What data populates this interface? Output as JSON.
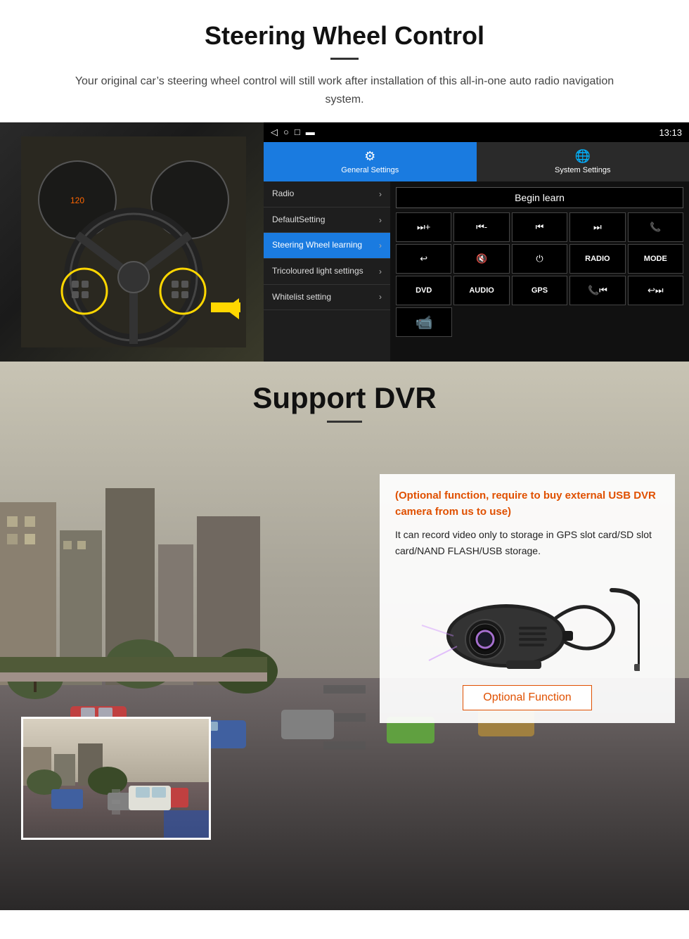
{
  "steering_section": {
    "title": "Steering Wheel Control",
    "subtitle": "Your original car’s steering wheel control will still work after installation of this all-in-one auto radio navigation system.",
    "status_bar": {
      "time": "13:13",
      "icons": [
        "◁",
        "○",
        "□",
        "▬"
      ]
    },
    "tabs": [
      {
        "id": "general",
        "label": "General Settings",
        "icon": "⚙",
        "active": true
      },
      {
        "id": "system",
        "label": "System Settings",
        "icon": "🌐",
        "active": false
      }
    ],
    "menu_items": [
      {
        "label": "Radio",
        "active": false
      },
      {
        "label": "DefaultSetting",
        "active": false
      },
      {
        "label": "Steering Wheel learning",
        "active": true
      },
      {
        "label": "Tricoloured light settings",
        "active": false
      },
      {
        "label": "Whitelist setting",
        "active": false
      }
    ],
    "begin_learn_label": "Begin learn",
    "control_buttons_row1": [
      {
        "icon": "⏮+",
        "label": ""
      },
      {
        "icon": "⏮-",
        "label": ""
      },
      {
        "icon": "⏮",
        "label": ""
      },
      {
        "icon": "⏭",
        "label": ""
      },
      {
        "icon": "📞",
        "label": ""
      }
    ],
    "control_buttons_row2": [
      {
        "icon": "↩",
        "label": ""
      },
      {
        "icon": "🔇×",
        "label": ""
      },
      {
        "icon": "⏻",
        "label": ""
      },
      {
        "text": "RADIO",
        "label": ""
      },
      {
        "text": "MODE",
        "label": ""
      }
    ],
    "control_buttons_row3": [
      {
        "text": "DVD",
        "label": ""
      },
      {
        "text": "AUDIO",
        "label": ""
      },
      {
        "text": "GPS",
        "label": ""
      },
      {
        "icon": "📞⏮",
        "label": ""
      },
      {
        "icon": "↩⏭",
        "label": ""
      }
    ],
    "control_buttons_row4": [
      {
        "icon": "📹",
        "label": ""
      }
    ]
  },
  "dvr_section": {
    "title": "Support DVR",
    "optional_text": "(Optional function, require to buy external USB DVR camera from us to use)",
    "description": "It can record video only to storage in GPS slot card/SD slot card/NAND FLASH/USB storage.",
    "optional_function_label": "Optional Function"
  }
}
